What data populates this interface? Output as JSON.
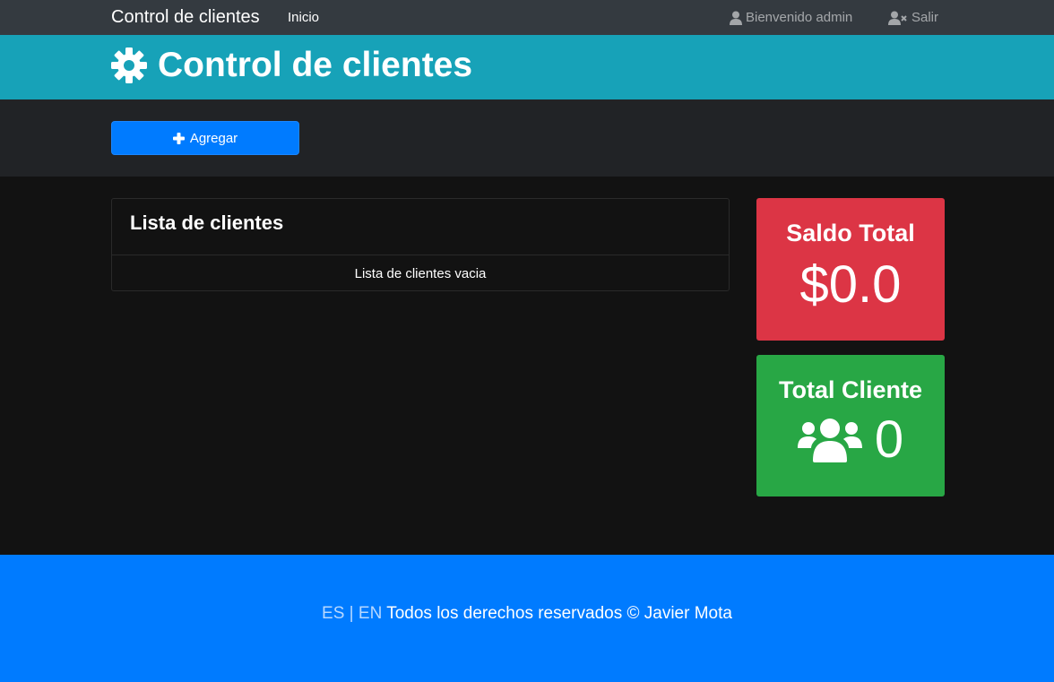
{
  "navbar": {
    "brand": "Control de clientes",
    "home_link": "Inicio",
    "welcome": "Bienvenido admin",
    "logout": "Salir"
  },
  "header": {
    "title": "Control de clientes",
    "icon": "gear-icon"
  },
  "actions": {
    "add_label": "Agregar"
  },
  "client_list": {
    "title": "Lista de clientes",
    "empty_message": "Lista de clientes vacia"
  },
  "stats": {
    "balance_title": "Saldo Total",
    "balance_value": "$0.0",
    "clients_title": "Total Cliente",
    "clients_value": "0"
  },
  "footer": {
    "lang_es": "ES",
    "separator": "|",
    "lang_en": "EN",
    "rights": "Todos los derechos reservados © Javier Mota"
  },
  "colors": {
    "navbar": "#343a40",
    "header": "#17a2b8",
    "primary": "#007bff",
    "danger": "#dc3545",
    "success": "#28a745"
  }
}
